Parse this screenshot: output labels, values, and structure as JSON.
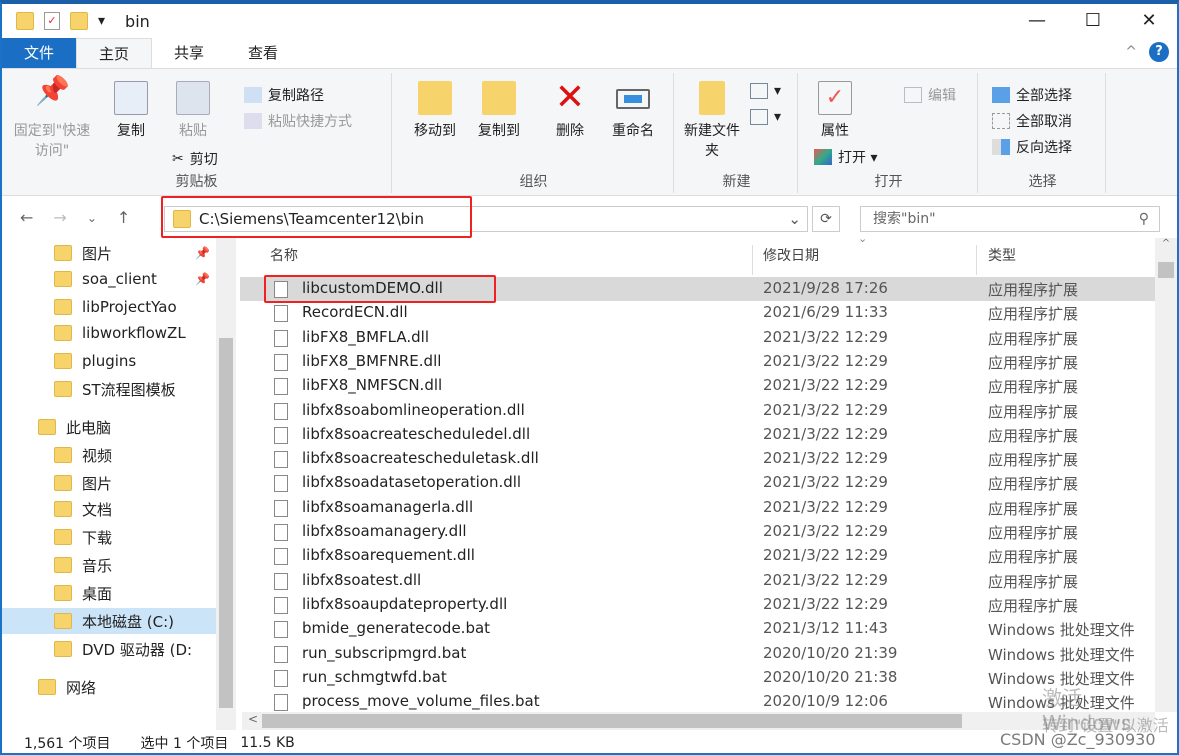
{
  "window": {
    "title": "bin",
    "minimize": "—",
    "maximize": "☐",
    "close": "✕"
  },
  "tabs": [
    "文件",
    "主页",
    "共享",
    "查看"
  ],
  "ribbon": {
    "clipboard": {
      "label": "剪贴板",
      "pin": "固定到\"快速访问\"",
      "copy": "复制",
      "paste": "粘贴",
      "copy_path": "复制路径",
      "paste_shortcut": "粘贴快捷方式",
      "cut": "剪切"
    },
    "organize": {
      "label": "组织",
      "move_to": "移动到",
      "copy_to": "复制到",
      "delete": "删除",
      "rename": "重命名"
    },
    "new": {
      "label": "新建",
      "new_folder": "新建文件夹"
    },
    "open": {
      "label": "打开",
      "properties": "属性",
      "open": "打开 ▾",
      "edit": "编辑"
    },
    "select": {
      "label": "选择",
      "select_all": "全部选择",
      "select_none": "全部取消",
      "invert": "反向选择"
    }
  },
  "address": {
    "path": "C:\\Siemens\\Teamcenter12\\bin",
    "search_placeholder": "搜索\"bin\""
  },
  "sidebar": [
    {
      "label": "图片",
      "pinned": true
    },
    {
      "label": "soa_client",
      "pinned": true
    },
    {
      "label": "libProjectYao"
    },
    {
      "label": "libworkflowZL"
    },
    {
      "label": "plugins"
    },
    {
      "label": "ST流程图模板"
    },
    {
      "label": "此电脑"
    },
    {
      "label": "视频"
    },
    {
      "label": "图片"
    },
    {
      "label": "文档"
    },
    {
      "label": "下载"
    },
    {
      "label": "音乐"
    },
    {
      "label": "桌面"
    },
    {
      "label": "本地磁盘 (C:)",
      "selected": true
    },
    {
      "label": "DVD 驱动器 (D:"
    },
    {
      "label": "网络"
    }
  ],
  "columns": [
    "名称",
    "修改日期",
    "类型"
  ],
  "files": [
    {
      "name": "libcustomDEMO.dll",
      "date": "2021/9/28 17:26",
      "type": "应用程序扩展",
      "selected": true
    },
    {
      "name": "RecordECN.dll",
      "date": "2021/6/29 11:33",
      "type": "应用程序扩展"
    },
    {
      "name": "libFX8_BMFLA.dll",
      "date": "2021/3/22 12:29",
      "type": "应用程序扩展"
    },
    {
      "name": "libFX8_BMFNRE.dll",
      "date": "2021/3/22 12:29",
      "type": "应用程序扩展"
    },
    {
      "name": "libFX8_NMFSCN.dll",
      "date": "2021/3/22 12:29",
      "type": "应用程序扩展"
    },
    {
      "name": "libfx8soabomlineoperation.dll",
      "date": "2021/3/22 12:29",
      "type": "应用程序扩展"
    },
    {
      "name": "libfx8soacreatescheduledel.dll",
      "date": "2021/3/22 12:29",
      "type": "应用程序扩展"
    },
    {
      "name": "libfx8soacreatescheduletask.dll",
      "date": "2021/3/22 12:29",
      "type": "应用程序扩展"
    },
    {
      "name": "libfx8soadatasetoperation.dll",
      "date": "2021/3/22 12:29",
      "type": "应用程序扩展"
    },
    {
      "name": "libfx8soamanagerla.dll",
      "date": "2021/3/22 12:29",
      "type": "应用程序扩展"
    },
    {
      "name": "libfx8soamanagery.dll",
      "date": "2021/3/22 12:29",
      "type": "应用程序扩展"
    },
    {
      "name": "libfx8soarequement.dll",
      "date": "2021/3/22 12:29",
      "type": "应用程序扩展"
    },
    {
      "name": "libfx8soatest.dll",
      "date": "2021/3/22 12:29",
      "type": "应用程序扩展"
    },
    {
      "name": "libfx8soaupdateproperty.dll",
      "date": "2021/3/22 12:29",
      "type": "应用程序扩展"
    },
    {
      "name": "bmide_generatecode.bat",
      "date": "2021/3/12 11:43",
      "type": "Windows 批处理文件"
    },
    {
      "name": "run_subscripmgrd.bat",
      "date": "2020/10/20 21:39",
      "type": "Windows 批处理文件"
    },
    {
      "name": "run_schmgtwfd.bat",
      "date": "2020/10/20 21:38",
      "type": "Windows 批处理文件"
    },
    {
      "name": "process_move_volume_files.bat",
      "date": "2020/10/9 12:06",
      "type": "Windows 批处理文件"
    }
  ],
  "status": {
    "count": "1,561 个项目",
    "selected": "选中 1 个项目",
    "size": "11.5 KB"
  },
  "watermark": {
    "activate": "激活 Windows",
    "activate_hint": "转到\"设置\"以激活",
    "csdn": "CSDN @Zc_930930"
  },
  "colors": {
    "accent": "#1a6fc4",
    "highlight": "#e22222"
  }
}
